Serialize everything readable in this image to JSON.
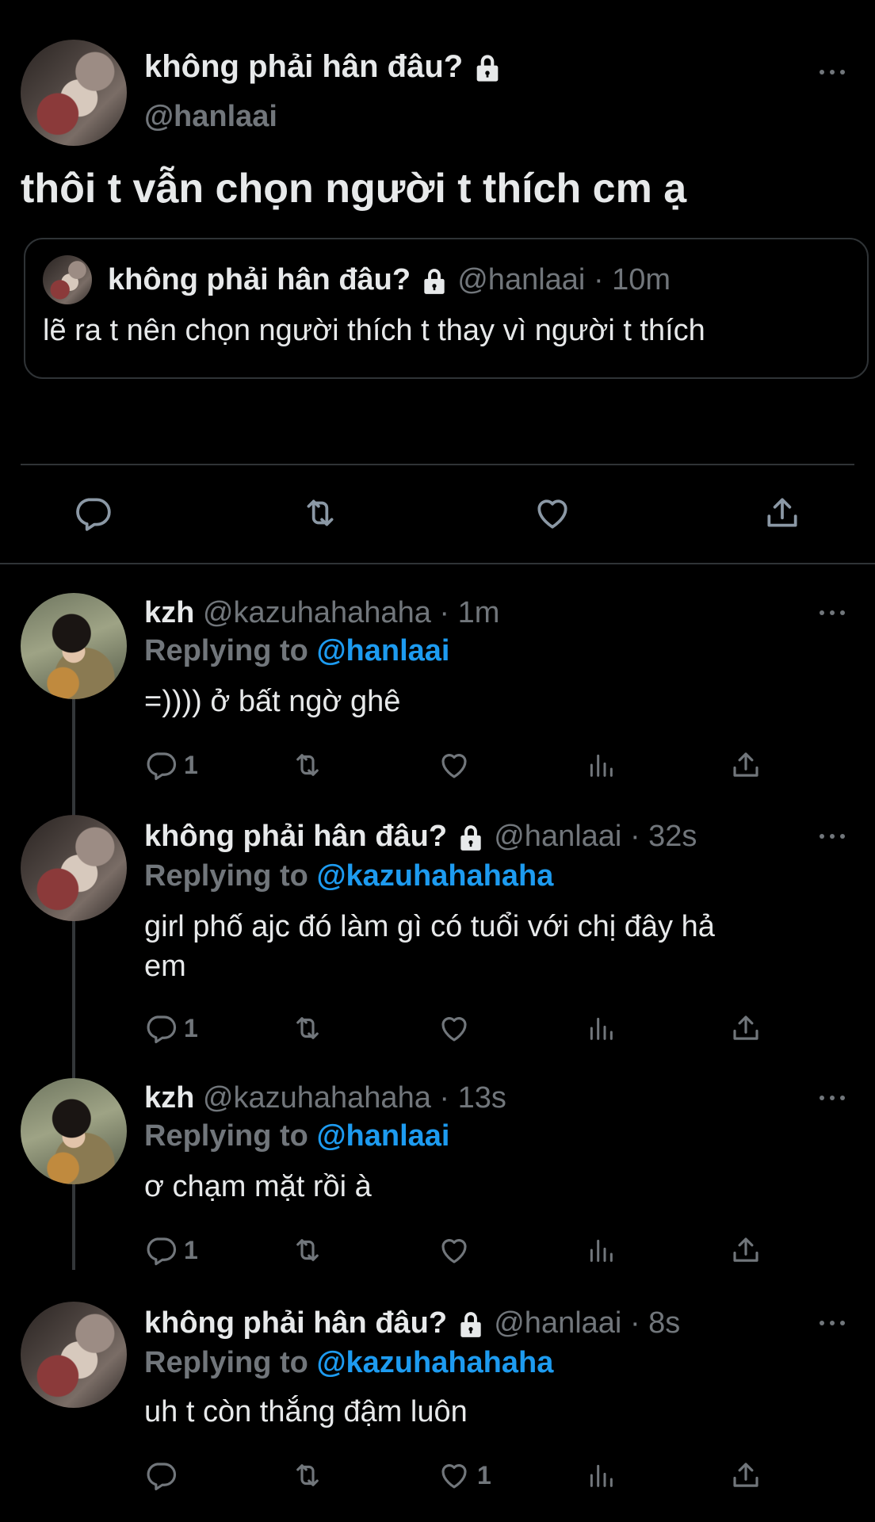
{
  "main_tweet": {
    "display_name": "không phải hân đâu?",
    "handle": "@hanlaai",
    "text": "thôi t vẫn chọn người t thích cm ạ",
    "quoted": {
      "display_name": "không phải hân đâu?",
      "handle": "@hanlaai",
      "time": "· 10m",
      "text": "lẽ ra t nên chọn người thích t thay vì người t thích"
    }
  },
  "replies": [
    {
      "display_name": "kzh",
      "handle": "@kazuhahahaha",
      "time": "· 1m",
      "replying_label": "Replying to",
      "replying_to": "@hanlaai",
      "text_lines": [
        "=)))) ở bất ngờ ghê"
      ],
      "reply_count": "1",
      "like_count": "",
      "locked": false
    },
    {
      "display_name": "không phải hân đâu?",
      "handle": "@hanlaai",
      "time": "· 32s",
      "replying_label": "Replying to",
      "replying_to": "@kazuhahahaha",
      "text_lines": [
        "girl phố ajc đó làm gì có tuổi với chị đây hả",
        "em"
      ],
      "reply_count": "1",
      "like_count": "",
      "locked": true
    },
    {
      "display_name": "kzh",
      "handle": "@kazuhahahaha",
      "time": "· 13s",
      "replying_label": "Replying to",
      "replying_to": "@hanlaai",
      "text_lines": [
        "ơ chạm mặt rồi à"
      ],
      "reply_count": "1",
      "like_count": "",
      "locked": false
    },
    {
      "display_name": "không phải hân đâu?",
      "handle": "@hanlaai",
      "time": "· 8s",
      "replying_label": "Replying to",
      "replying_to": "@kazuhahahaha",
      "text_lines": [
        "uh t còn thắng đậm luôn"
      ],
      "reply_count": "",
      "like_count": "1",
      "locked": true
    }
  ],
  "icons": {
    "reply": "reply-icon",
    "retweet": "retweet-icon",
    "like": "heart-icon",
    "views": "views-icon",
    "share": "share-icon",
    "lock": "lock-icon",
    "more": "more-icon"
  }
}
